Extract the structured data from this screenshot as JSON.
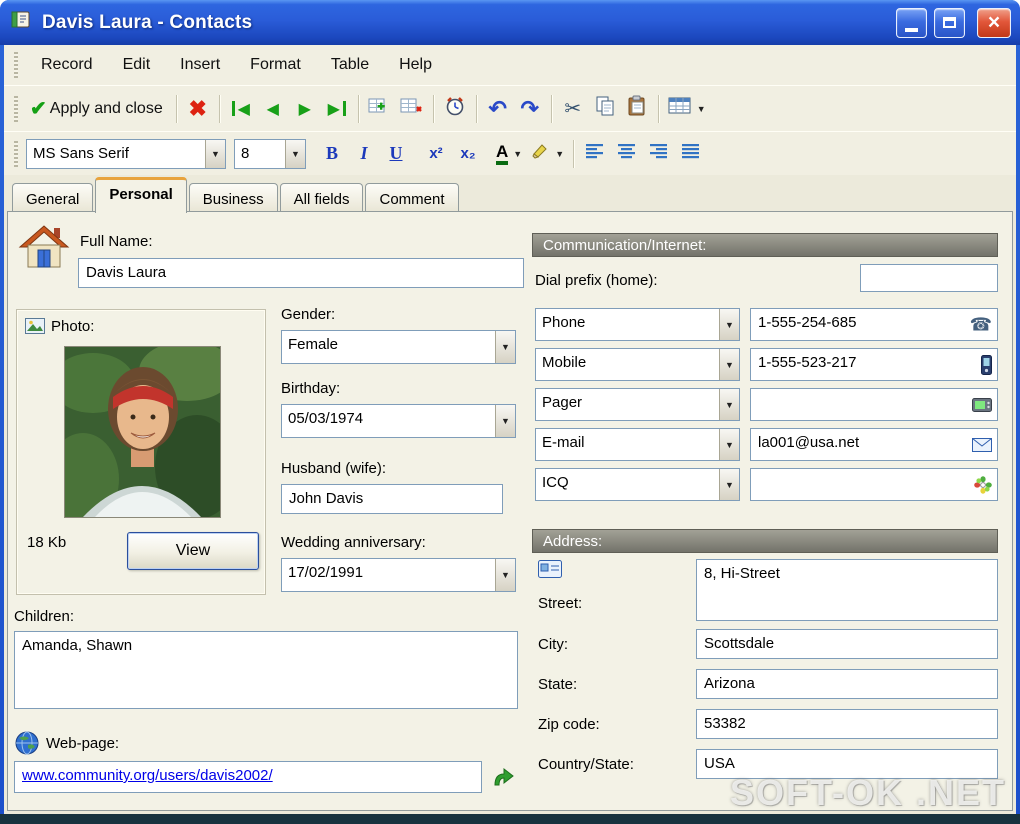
{
  "window": {
    "title": "Davis Laura - Contacts"
  },
  "menu": {
    "items": [
      "Record",
      "Edit",
      "Insert",
      "Format",
      "Table",
      "Help"
    ]
  },
  "toolbar": {
    "apply_and_close": "Apply and close"
  },
  "format_bar": {
    "font_name": "MS Sans Serif",
    "font_size": "8",
    "bold": "B",
    "italic": "I",
    "underline": "U",
    "superscript": "x²",
    "subscript": "x₂",
    "font_color": "A"
  },
  "tabs": {
    "items": [
      "General",
      "Personal",
      "Business",
      "All fields",
      "Comment"
    ],
    "active": "Personal"
  },
  "personal": {
    "full_name_label": "Full Name:",
    "full_name": "Davis Laura",
    "photo_label": "Photo:",
    "photo_size": "18 Kb",
    "view_button": "View",
    "gender_label": "Gender:",
    "gender": "Female",
    "birthday_label": "Birthday:",
    "birthday": "05/03/1974",
    "spouse_label": "Husband (wife):",
    "spouse": "John Davis",
    "anniversary_label": "Wedding anniversary:",
    "anniversary": "17/02/1991",
    "children_label": "Children:",
    "children": "Amanda, Shawn",
    "webpage_label": "Web-page:",
    "webpage": "www.community.org/users/davis2002/"
  },
  "communication": {
    "header": "Communication/Internet:",
    "dial_prefix_label": "Dial prefix (home):",
    "dial_prefix": "",
    "rows": [
      {
        "type": "Phone",
        "value": "1-555-254-685"
      },
      {
        "type": "Mobile",
        "value": "1-555-523-217"
      },
      {
        "type": "Pager",
        "value": ""
      },
      {
        "type": "E-mail",
        "value": "la001@usa.net"
      },
      {
        "type": "ICQ",
        "value": ""
      }
    ]
  },
  "address": {
    "header": "Address:",
    "street_label": "Street:",
    "street": "8, Hi-Street",
    "city_label": "City:",
    "city": "Scottsdale",
    "state_label": "State:",
    "state": "Arizona",
    "zip_label": "Zip code:",
    "zip": "53382",
    "country_label": "Country/State:",
    "country": "USA"
  },
  "watermark": "SOFT-OK .NET"
}
